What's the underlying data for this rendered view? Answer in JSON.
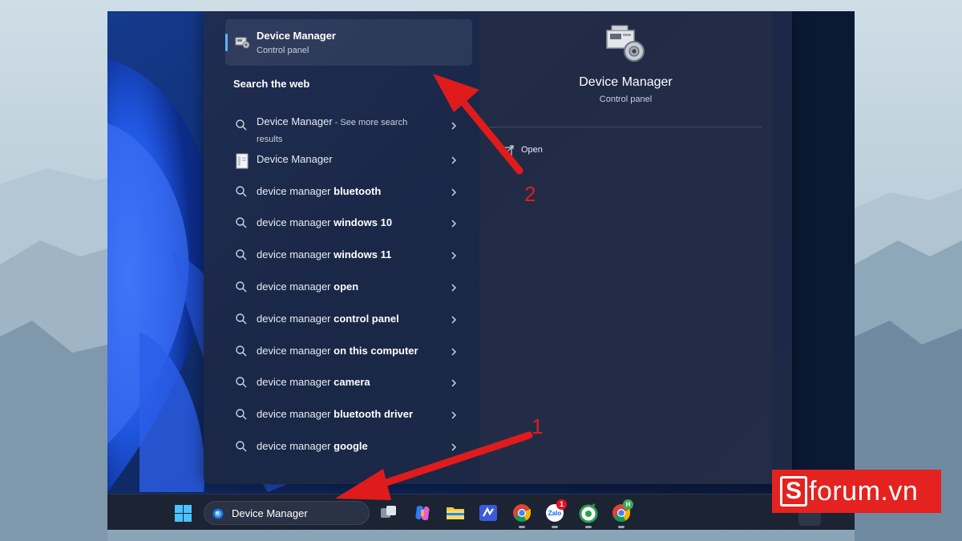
{
  "best_match": {
    "title": "Device Manager",
    "subtitle": "Control panel"
  },
  "search_web": {
    "heading": "Search the web",
    "results": [
      {
        "prefix": "Device Manager",
        "bold": "",
        "suffix": " - See more search results",
        "icon": "search-icon"
      },
      {
        "prefix": "Device Manager",
        "bold": "",
        "suffix": "",
        "icon": "device-manager-file-icon"
      },
      {
        "prefix": "device manager ",
        "bold": "bluetooth",
        "suffix": "",
        "icon": "search-icon"
      },
      {
        "prefix": "device manager ",
        "bold": "windows 10",
        "suffix": "",
        "icon": "search-icon"
      },
      {
        "prefix": "device manager ",
        "bold": "windows 11",
        "suffix": "",
        "icon": "search-icon"
      },
      {
        "prefix": "device manager ",
        "bold": "open",
        "suffix": "",
        "icon": "search-icon"
      },
      {
        "prefix": "device manager ",
        "bold": "control panel",
        "suffix": "",
        "icon": "search-icon"
      },
      {
        "prefix": "device manager ",
        "bold": "on this computer",
        "suffix": "",
        "icon": "search-icon"
      },
      {
        "prefix": "device manager ",
        "bold": "camera",
        "suffix": "",
        "icon": "search-icon"
      },
      {
        "prefix": "device manager ",
        "bold": "bluetooth driver",
        "suffix": "",
        "icon": "search-icon"
      },
      {
        "prefix": "device manager ",
        "bold": "google",
        "suffix": "",
        "icon": "search-icon"
      }
    ]
  },
  "detail": {
    "title": "Device Manager",
    "subtitle": "Control panel",
    "actions": [
      {
        "label": "Open",
        "icon": "open-external-icon"
      }
    ]
  },
  "taskbar": {
    "search_value": "Device Manager",
    "apps": [
      {
        "name": "task-view-icon"
      },
      {
        "name": "copilot-icon"
      },
      {
        "name": "file-explorer-icon"
      },
      {
        "name": "vscode-icon"
      },
      {
        "name": "chrome-icon"
      },
      {
        "name": "zalo-icon",
        "badge": "1"
      },
      {
        "name": "coc-coc-icon"
      },
      {
        "name": "chrome-profile-icon",
        "badge": "H"
      }
    ]
  },
  "annotations": {
    "step_1": "1",
    "step_2": "2",
    "arrow_color": "#e01b1b"
  },
  "brand": {
    "s": "S",
    "text": "forum.vn",
    "color": "#e4221f"
  }
}
